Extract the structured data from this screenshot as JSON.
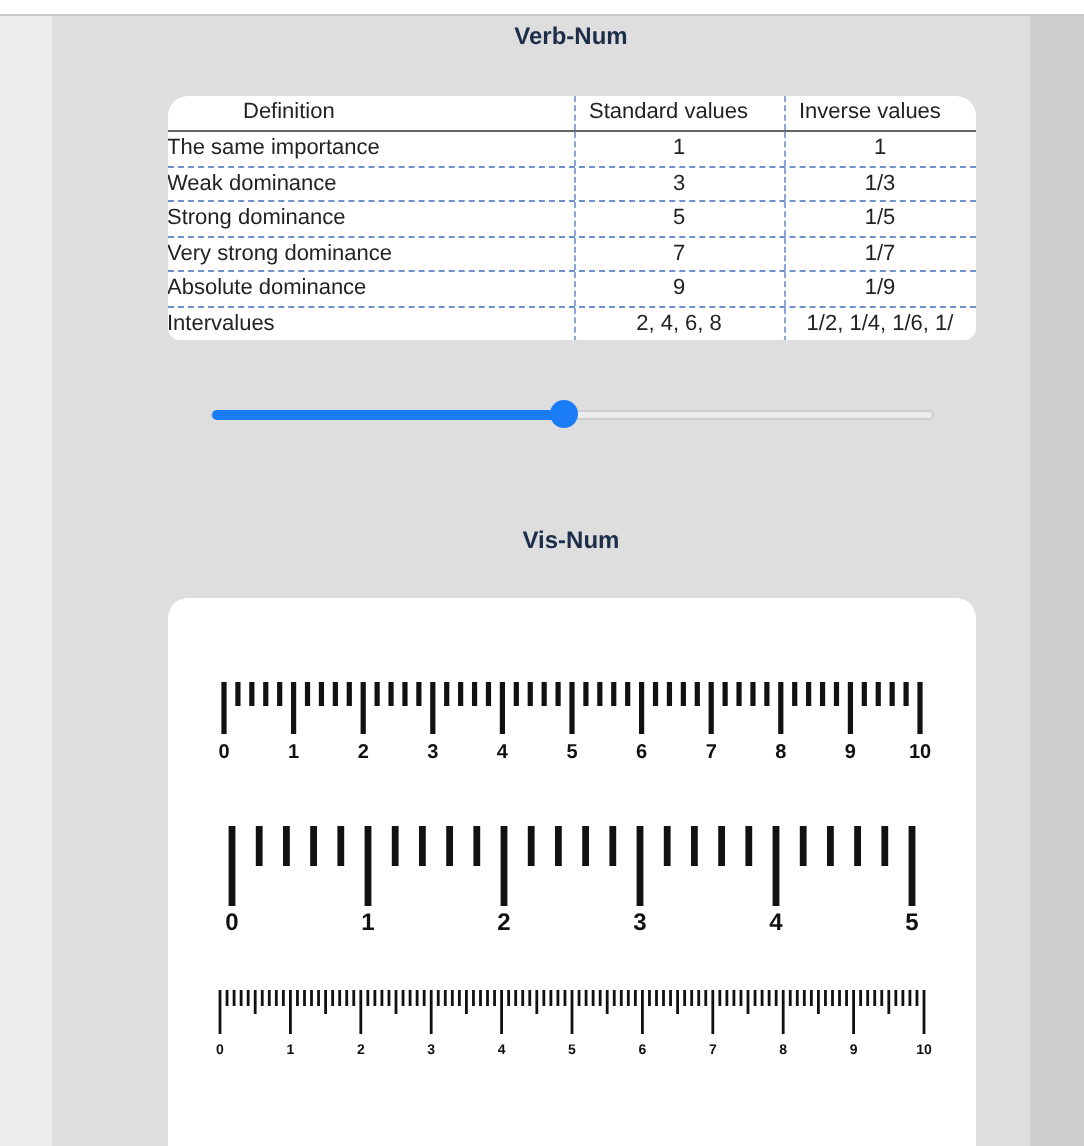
{
  "verb_num": {
    "title": "Verb-Num",
    "table": {
      "columns": [
        "Definition",
        "Standard values",
        "Inverse values"
      ],
      "rows": [
        [
          "The same importance",
          "1",
          "1"
        ],
        [
          "Weak dominance",
          "3",
          "1/3"
        ],
        [
          "Strong dominance",
          "5",
          "1/5"
        ],
        [
          "Very strong dominance",
          "7",
          "1/7"
        ],
        [
          "Absolute dominance",
          "9",
          "1/9"
        ],
        [
          "Intervalues",
          "2, 4, 6, 8",
          "1/2, 1/4, 1/6, 1/"
        ]
      ]
    },
    "slider": {
      "level": 0.49
    }
  },
  "vis_num": {
    "title": "Vis-Num",
    "rulers": [
      {
        "kind": "medium",
        "labels": [
          "0",
          "1",
          "2",
          "3",
          "4",
          "5",
          "6",
          "7",
          "8",
          "9",
          "10"
        ]
      },
      {
        "kind": "large",
        "labels": [
          "0",
          "1",
          "2",
          "3",
          "4",
          "5"
        ]
      },
      {
        "kind": "small",
        "labels": [
          "0",
          "1",
          "2",
          "3",
          "4",
          "5",
          "6",
          "7",
          "8",
          "9",
          "10"
        ]
      }
    ]
  }
}
